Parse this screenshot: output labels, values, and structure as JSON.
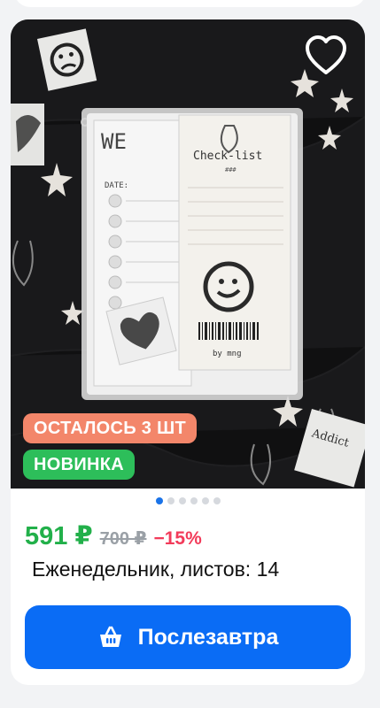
{
  "product": {
    "price": "591 ₽",
    "old_price": "700 ₽",
    "discount": "−15%",
    "title": "Еженедельник, листов: 14",
    "badges": {
      "stock_left": "ОСТАЛОСЬ 3 ШТ",
      "new": "НОВИНКА"
    },
    "photo": {
      "image_count": 6,
      "active_index": 0,
      "checklist_title": "Check-list",
      "checklist_sub": "###",
      "brand": "by mng",
      "date_label": "DATE:",
      "addict_text": "Addict"
    }
  },
  "cta": {
    "label": "Послезавтра",
    "icon": "basket-icon"
  },
  "colors": {
    "price": "#22b04a",
    "discount": "#f23b5a",
    "cta": "#0a6cf5",
    "badge_stock": "#f3866a",
    "badge_new": "#2dbe5a"
  }
}
